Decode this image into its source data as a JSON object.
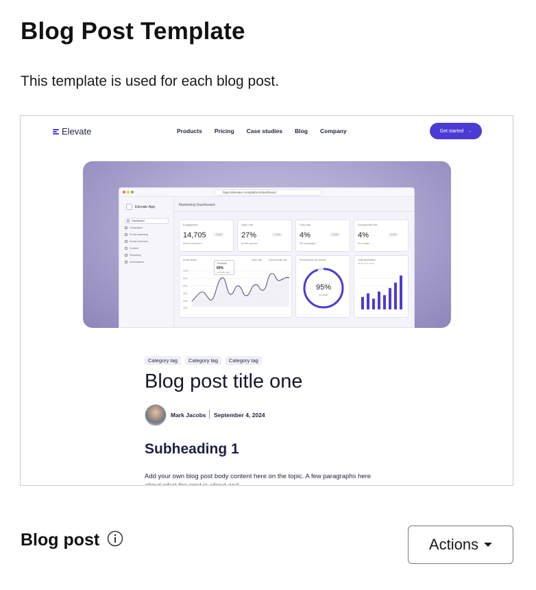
{
  "page": {
    "title": "Blog Post Template",
    "description": "This template is used for each blog post."
  },
  "preview": {
    "site": {
      "logo_text": "Elevate",
      "nav": [
        "Products",
        "Pricing",
        "Case studies",
        "Blog",
        "Company"
      ],
      "cta_label": "Get started",
      "accent_color": "#4b3bd4"
    },
    "hero": {
      "browser_url": "https://elevate.com/platform/dashboard",
      "app_name": "Elevate App",
      "sidebar": [
        "Dashboard",
        "Campaigns",
        "Email marketing",
        "Social channels",
        "Content",
        "Reporting",
        "Automations"
      ],
      "dashboard_title": "Marketing Dashboard",
      "kpis": [
        {
          "label": "Engagement",
          "value": "14,705",
          "delta": "+2.5%",
          "sub": "Active customers"
        },
        {
          "label": "Open rate",
          "value": "27%",
          "delta": "+1.5%",
          "sub": "Emails opened"
        },
        {
          "label": "Click rate",
          "value": "4%",
          "delta": "+2.5%",
          "sub": "Per campaigns"
        },
        {
          "label": "Unsubscribe rate",
          "value": "4%",
          "delta": "-0.4%",
          "sub": "Per emails"
        }
      ],
      "email_card": {
        "title": "Email health",
        "legend": [
          "Open rate",
          "Click-through rate"
        ],
        "tooltip_day": "Thursday",
        "tooltip_value": "60%",
        "tooltip_sub": "of emails read",
        "y_ticks": [
          "100%",
          "80%",
          "60%",
          "40%",
          "20%",
          "10%"
        ]
      },
      "perf_card": {
        "title": "Performance by channel",
        "value": "95%",
        "sub": "of target",
        "fraction": 0.95
      },
      "lead_card": {
        "title": "Lead generation",
        "sub": "Month over month",
        "bars": [
          0.35,
          0.45,
          0.3,
          0.5,
          0.4,
          0.6,
          0.75,
          0.95
        ]
      }
    },
    "article": {
      "tags": [
        "Category tag",
        "Category tag",
        "Category tag"
      ],
      "title": "Blog post title one",
      "author": "Mark Jacobs",
      "date": "September 4, 2024",
      "subheading": "Subheading 1",
      "body": "Add your own blog post body content here on the topic. A few paragraphs here",
      "body_cut": "about what the post is about and"
    }
  },
  "section": {
    "title": "Blog post",
    "actions_label": "Actions"
  }
}
